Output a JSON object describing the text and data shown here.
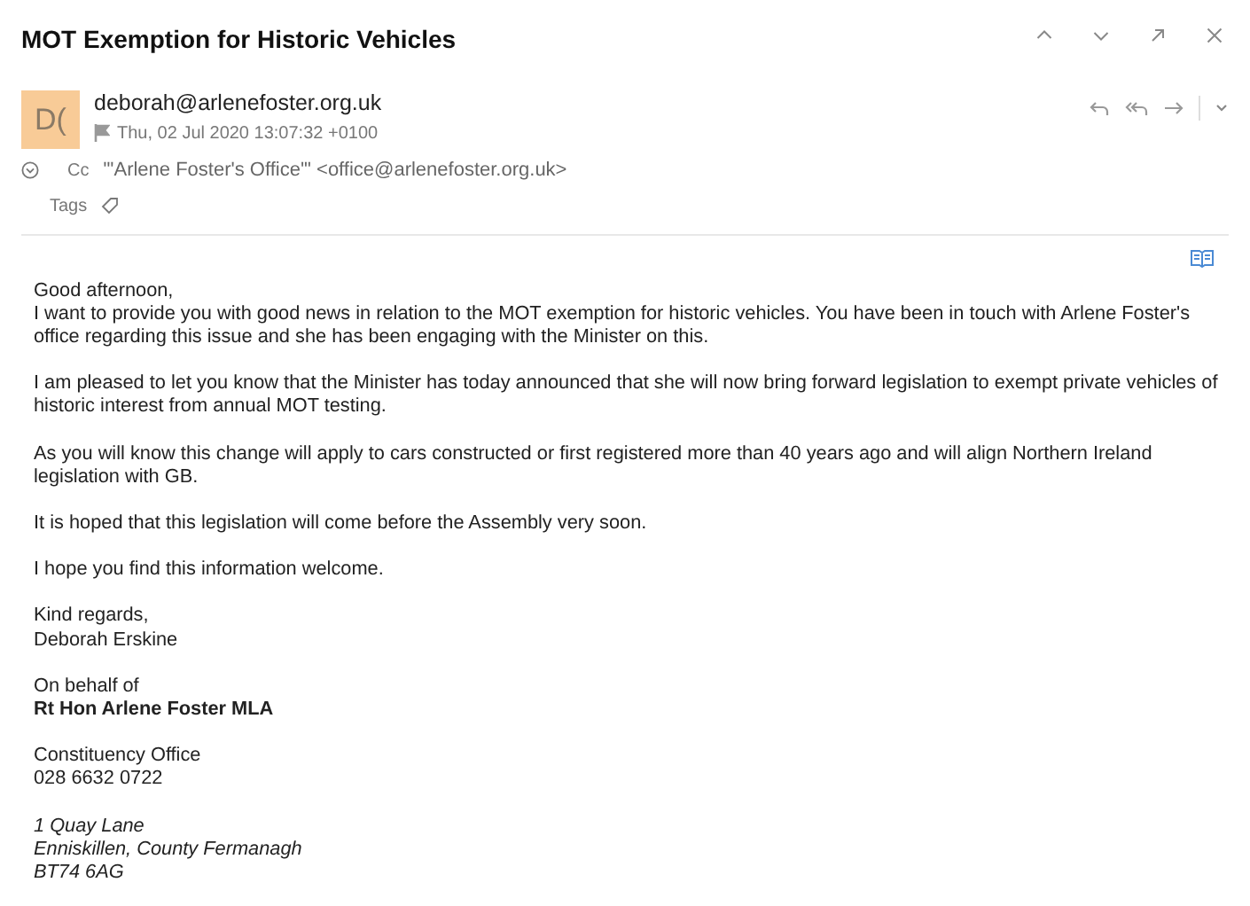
{
  "subject": "MOT Exemption for Historic Vehicles",
  "sender": {
    "avatar": "D(",
    "email": "deborah@arlenefoster.org.uk",
    "date": "Thu, 02 Jul 2020 13:07:32 +0100",
    "flagged": false
  },
  "cc": {
    "label": "Cc",
    "value": "\"'Arlene Foster's Office'\" <office@arlenefoster.org.uk>"
  },
  "tags": {
    "label": "Tags"
  },
  "body": [
    {
      "lines": [
        {
          "text": "Good afternoon,"
        },
        {
          "text": "I want to provide you with good news in relation to the MOT exemption for historic vehicles. You have been in touch with Arlene Foster's"
        },
        {
          "text": "office regarding this issue and she has been engaging with the Minister on this."
        }
      ]
    },
    {
      "lines": [
        {
          "text": "I am pleased to let you know that the Minister has today announced that she will now bring forward legislation to exempt private vehicles of"
        },
        {
          "text": "historic interest from annual MOT testing."
        }
      ]
    },
    {
      "lines": [
        {
          "text": "As you will know this change will apply to cars constructed or first registered more than 40 years ago and will align Northern Ireland"
        },
        {
          "text": "legislation with GB."
        }
      ]
    },
    {
      "lines": [
        {
          "text": "It is hoped that this legislation will come before the Assembly very soon."
        }
      ]
    },
    {
      "lines": [
        {
          "text": "I hope you find this information welcome."
        }
      ]
    },
    {
      "lines": [
        {
          "text": "Kind regards,"
        },
        {
          "text": "Deborah Erskine"
        }
      ]
    },
    {
      "lines": [
        {
          "text": "On behalf of"
        },
        {
          "text": "Rt Hon Arlene Foster MLA",
          "kind": "signatory"
        }
      ]
    },
    {
      "lines": [
        {
          "text": "Constituency Office"
        },
        {
          "text": "028 6632 0722"
        }
      ]
    },
    {
      "lines": [
        {
          "text": "1 Quay Lane",
          "kind": "address"
        },
        {
          "text": "Enniskillen, County Fermanagh",
          "kind": "address"
        },
        {
          "text": "BT74 6AG",
          "kind": "address"
        }
      ]
    }
  ]
}
